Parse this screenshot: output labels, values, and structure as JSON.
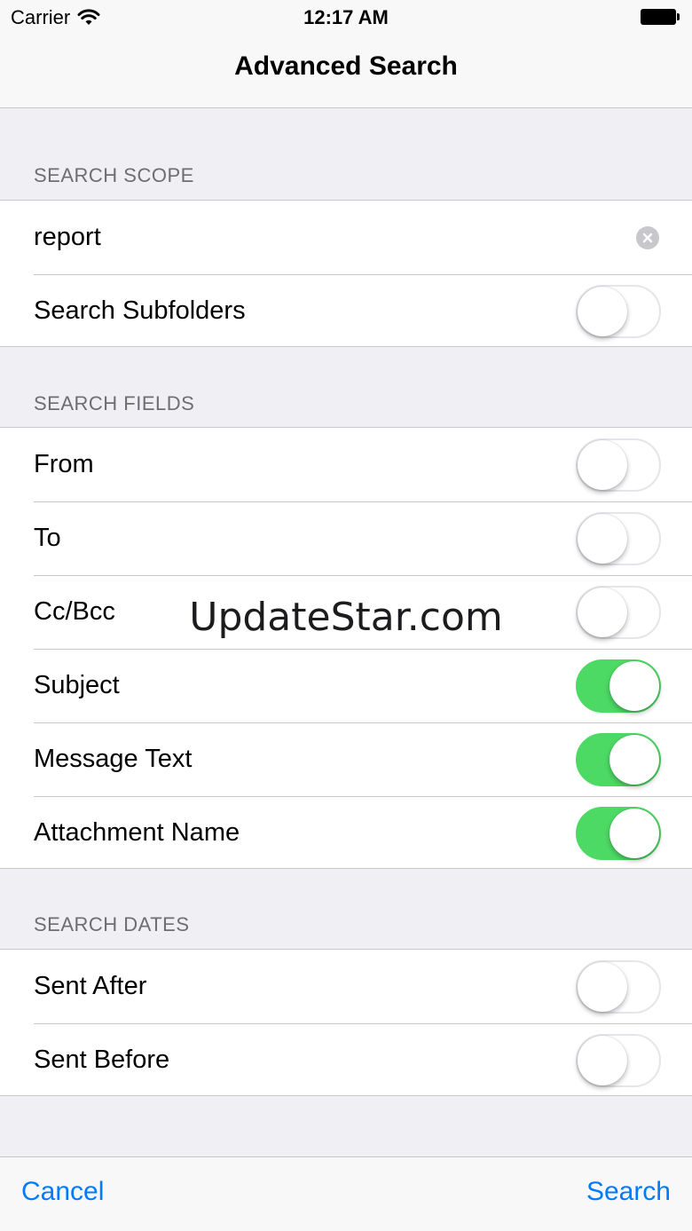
{
  "status_bar": {
    "carrier": "Carrier",
    "time": "12:17 AM"
  },
  "nav": {
    "title": "Advanced Search"
  },
  "scope": {
    "header": "SEARCH SCOPE",
    "query": "report",
    "subfolders_label": "Search Subfolders",
    "subfolders_on": false
  },
  "fields": {
    "header": "SEARCH FIELDS",
    "items": [
      {
        "label": "From",
        "on": false
      },
      {
        "label": "To",
        "on": false
      },
      {
        "label": "Cc/Bcc",
        "on": false
      },
      {
        "label": "Subject",
        "on": true
      },
      {
        "label": "Message Text",
        "on": true
      },
      {
        "label": "Attachment Name",
        "on": true
      }
    ]
  },
  "dates": {
    "header": "SEARCH DATES",
    "items": [
      {
        "label": "Sent After",
        "on": false
      },
      {
        "label": "Sent Before",
        "on": false
      }
    ]
  },
  "watermark": "UpdateStar.com",
  "toolbar": {
    "cancel_label": "Cancel",
    "search_label": "Search"
  },
  "colors": {
    "accent": "#007aff",
    "toggle_on": "#4cd964",
    "background": "#efeff4"
  }
}
